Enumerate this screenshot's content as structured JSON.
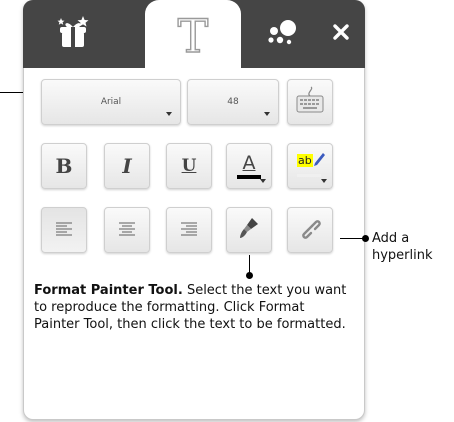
{
  "tabs": {
    "gifts_icon": "gift-box-stars-icon",
    "text_tab_label": "T",
    "shapes_icon": "dots-shapes-icon",
    "close_icon": "close-x-icon"
  },
  "toolbar": {
    "font_family_value": "Arial",
    "font_size_value": "48",
    "keyboard_icon": "keyboard-icon",
    "bold_label": "B",
    "italic_label": "I",
    "underline_label": "U",
    "font_color_label": "A",
    "highlight_label": "ab",
    "align_left_icon": "align-left-icon",
    "align_center_icon": "align-center-icon",
    "align_right_icon": "align-right-icon",
    "format_painter_icon": "paint-brush-icon",
    "hyperlink_icon": "chain-link-icon"
  },
  "colors": {
    "tabbar_bg": "#454545",
    "font_color_bar": "#000000",
    "highlight_color": "#ffff00"
  },
  "annotations": {
    "hyperlink_note": "Add a hyperlink",
    "format_painter_title": "Format Painter Tool.",
    "format_painter_body": "Select the text you want to reproduce the formatting. Click Format Painter Tool, then click the text to be formatted."
  }
}
